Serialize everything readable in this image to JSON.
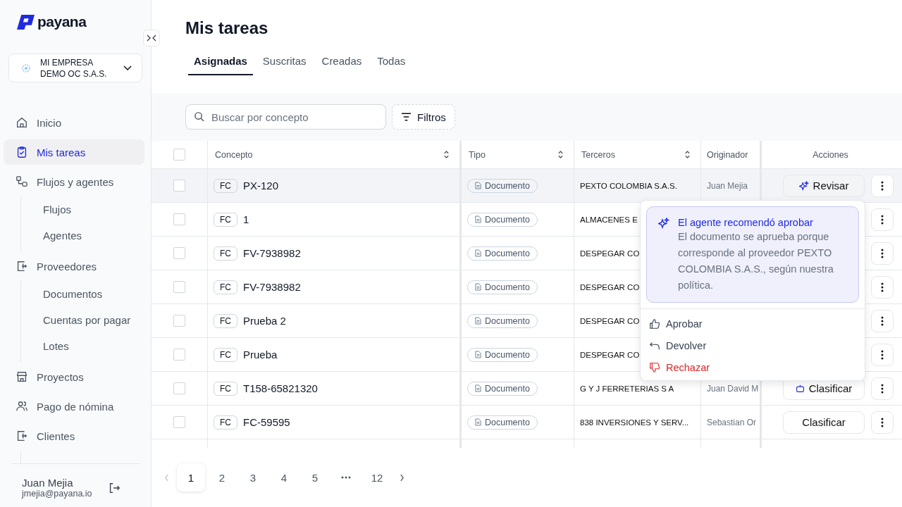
{
  "brand": {
    "name": "payana"
  },
  "company": {
    "name": "MI EMPRESA DEMO OC S.A.S."
  },
  "nav": [
    {
      "label": "Inicio",
      "kind": "home",
      "selected": false
    },
    {
      "label": "Mis tareas",
      "kind": "clipboard",
      "selected": true
    },
    {
      "label": "Flujos y agentes",
      "kind": "flow",
      "selected": false,
      "children": [
        {
          "label": "Flujos",
          "selected": false
        },
        {
          "label": "Agentes",
          "selected": false
        }
      ]
    },
    {
      "label": "Proveedores",
      "kind": "money",
      "selected": false,
      "children": [
        {
          "label": "Documentos",
          "selected": false
        },
        {
          "label": "Cuentas por pagar",
          "selected": false
        },
        {
          "label": "Lotes",
          "selected": false
        }
      ]
    },
    {
      "label": "Proyectos",
      "kind": "store",
      "selected": false
    },
    {
      "label": "Pago de nómina",
      "kind": "people",
      "selected": false
    },
    {
      "label": "Clientes",
      "kind": "money",
      "selected": false
    }
  ],
  "user": {
    "name": "Juan Mejia",
    "email": "jmejia@payana.io"
  },
  "page": {
    "title": "Mis tareas"
  },
  "tabs": [
    {
      "label": "Asignadas",
      "selected": true
    },
    {
      "label": "Suscritas",
      "selected": false
    },
    {
      "label": "Creadas",
      "selected": false
    },
    {
      "label": "Todas",
      "selected": false
    }
  ],
  "search": {
    "placeholder": "Buscar por concepto"
  },
  "filters_button": "Filtros",
  "table": {
    "all_checked": false,
    "columns": [
      {
        "label": "Concepto",
        "sortable": true
      },
      {
        "label": "Tipo",
        "sortable": true
      },
      {
        "label": "Terceros",
        "sortable": true
      },
      {
        "label": "Originador",
        "sortable": false
      },
      {
        "label": "Acciones",
        "sortable": false
      }
    ],
    "rows": [
      {
        "checked": false,
        "hovered": true,
        "prefix": "FC",
        "concept": "PX-120",
        "type": "Documento",
        "third_party": "PEXTO COLOMBIA S.A.S.",
        "originator": "Juan Mejia",
        "action": {
          "label": "Revisar",
          "kind": "review"
        }
      },
      {
        "checked": false,
        "hovered": false,
        "prefix": "FC",
        "concept": "1",
        "type": "Documento",
        "third_party": "ALMACENES E"
      },
      {
        "checked": false,
        "hovered": false,
        "prefix": "FC",
        "concept": "FV-7938982",
        "type": "Documento",
        "third_party": "DESPEGAR CO"
      },
      {
        "checked": false,
        "hovered": false,
        "prefix": "FC",
        "concept": "FV-7938982",
        "type": "Documento",
        "third_party": "DESPEGAR CO"
      },
      {
        "checked": false,
        "hovered": false,
        "prefix": "FC",
        "concept": "Prueba 2",
        "type": "Documento",
        "third_party": "DESPEGAR CO"
      },
      {
        "checked": false,
        "hovered": false,
        "prefix": "FC",
        "concept": "Prueba",
        "type": "Documento",
        "third_party": "DESPEGAR CO"
      },
      {
        "checked": false,
        "hovered": false,
        "prefix": "FC",
        "concept": "T158-65821320",
        "type": "Documento",
        "third_party": "G Y J FERRETERIAS S A",
        "originator": "Juan David M",
        "action": {
          "label": "Clasificar",
          "kind": "agent"
        }
      },
      {
        "checked": false,
        "hovered": false,
        "prefix": "FC",
        "concept": "FC-59595",
        "type": "Documento",
        "third_party": "838 INVERSIONES Y SERV...",
        "originator": "Sebastian Or",
        "action": {
          "label": "Clasificar",
          "kind": "plain"
        }
      }
    ]
  },
  "popover": {
    "title": "El agente recomendó aprobar",
    "body": "El documento se aprueba porque corresponde al proveedor PEXTO COLOMBIA S.A.S., según nuestra política.",
    "options": [
      {
        "label": "Aprobar",
        "kind": "approve"
      },
      {
        "label": "Devolver",
        "kind": "return"
      },
      {
        "label": "Rechazar",
        "kind": "reject"
      }
    ]
  },
  "pagination": {
    "prev_disabled": true,
    "pages": [
      {
        "label": "1",
        "selected": true,
        "kind": "page"
      },
      {
        "label": "2",
        "selected": false,
        "kind": "page"
      },
      {
        "label": "3",
        "selected": false,
        "kind": "page"
      },
      {
        "label": "4",
        "selected": false,
        "kind": "page"
      },
      {
        "label": "5",
        "selected": false,
        "kind": "page"
      },
      {
        "selected": false,
        "kind": "ellipsis"
      },
      {
        "label": "12",
        "selected": false,
        "kind": "page"
      }
    ]
  }
}
